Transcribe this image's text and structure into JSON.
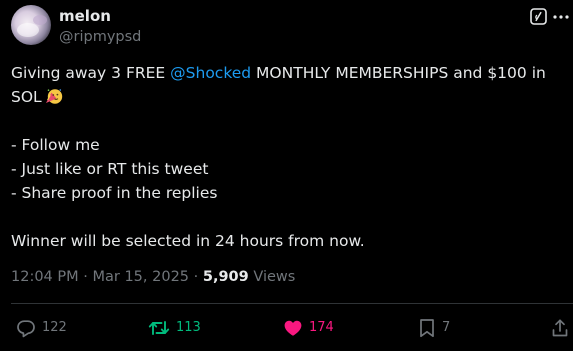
{
  "author": {
    "display_name": "melon",
    "handle": "@ripmypsd",
    "avatar_icon": "avatar-photo"
  },
  "post": {
    "line1_before": "Giving away 3 FREE ",
    "mention": "@Shocked",
    "line1_after": " MONTHLY MEMBERSHIPS and $100 in",
    "line2": "SOL",
    "emoji_icon": "partying-face-emoji",
    "steps": [
      "- Follow me",
      "- Just like or RT this tweet",
      "- Share proof in the replies"
    ],
    "closing": "Winner will be selected in 24 hours from now."
  },
  "meta": {
    "time": "12:04 PM",
    "dot1": " · ",
    "date": "Mar 15, 2025",
    "dot2": " · ",
    "views_count": "5,909",
    "views_label": " Views"
  },
  "actions": {
    "replies": "122",
    "reposts": "113",
    "likes": "174",
    "bookmarks": "7"
  },
  "colors": {
    "background": "#000000",
    "text": "#e7e9ea",
    "muted": "#71767b",
    "link": "#1d9bf0",
    "repost_active": "#00ba7c",
    "like_active": "#f91880",
    "divider": "#2f3336"
  }
}
